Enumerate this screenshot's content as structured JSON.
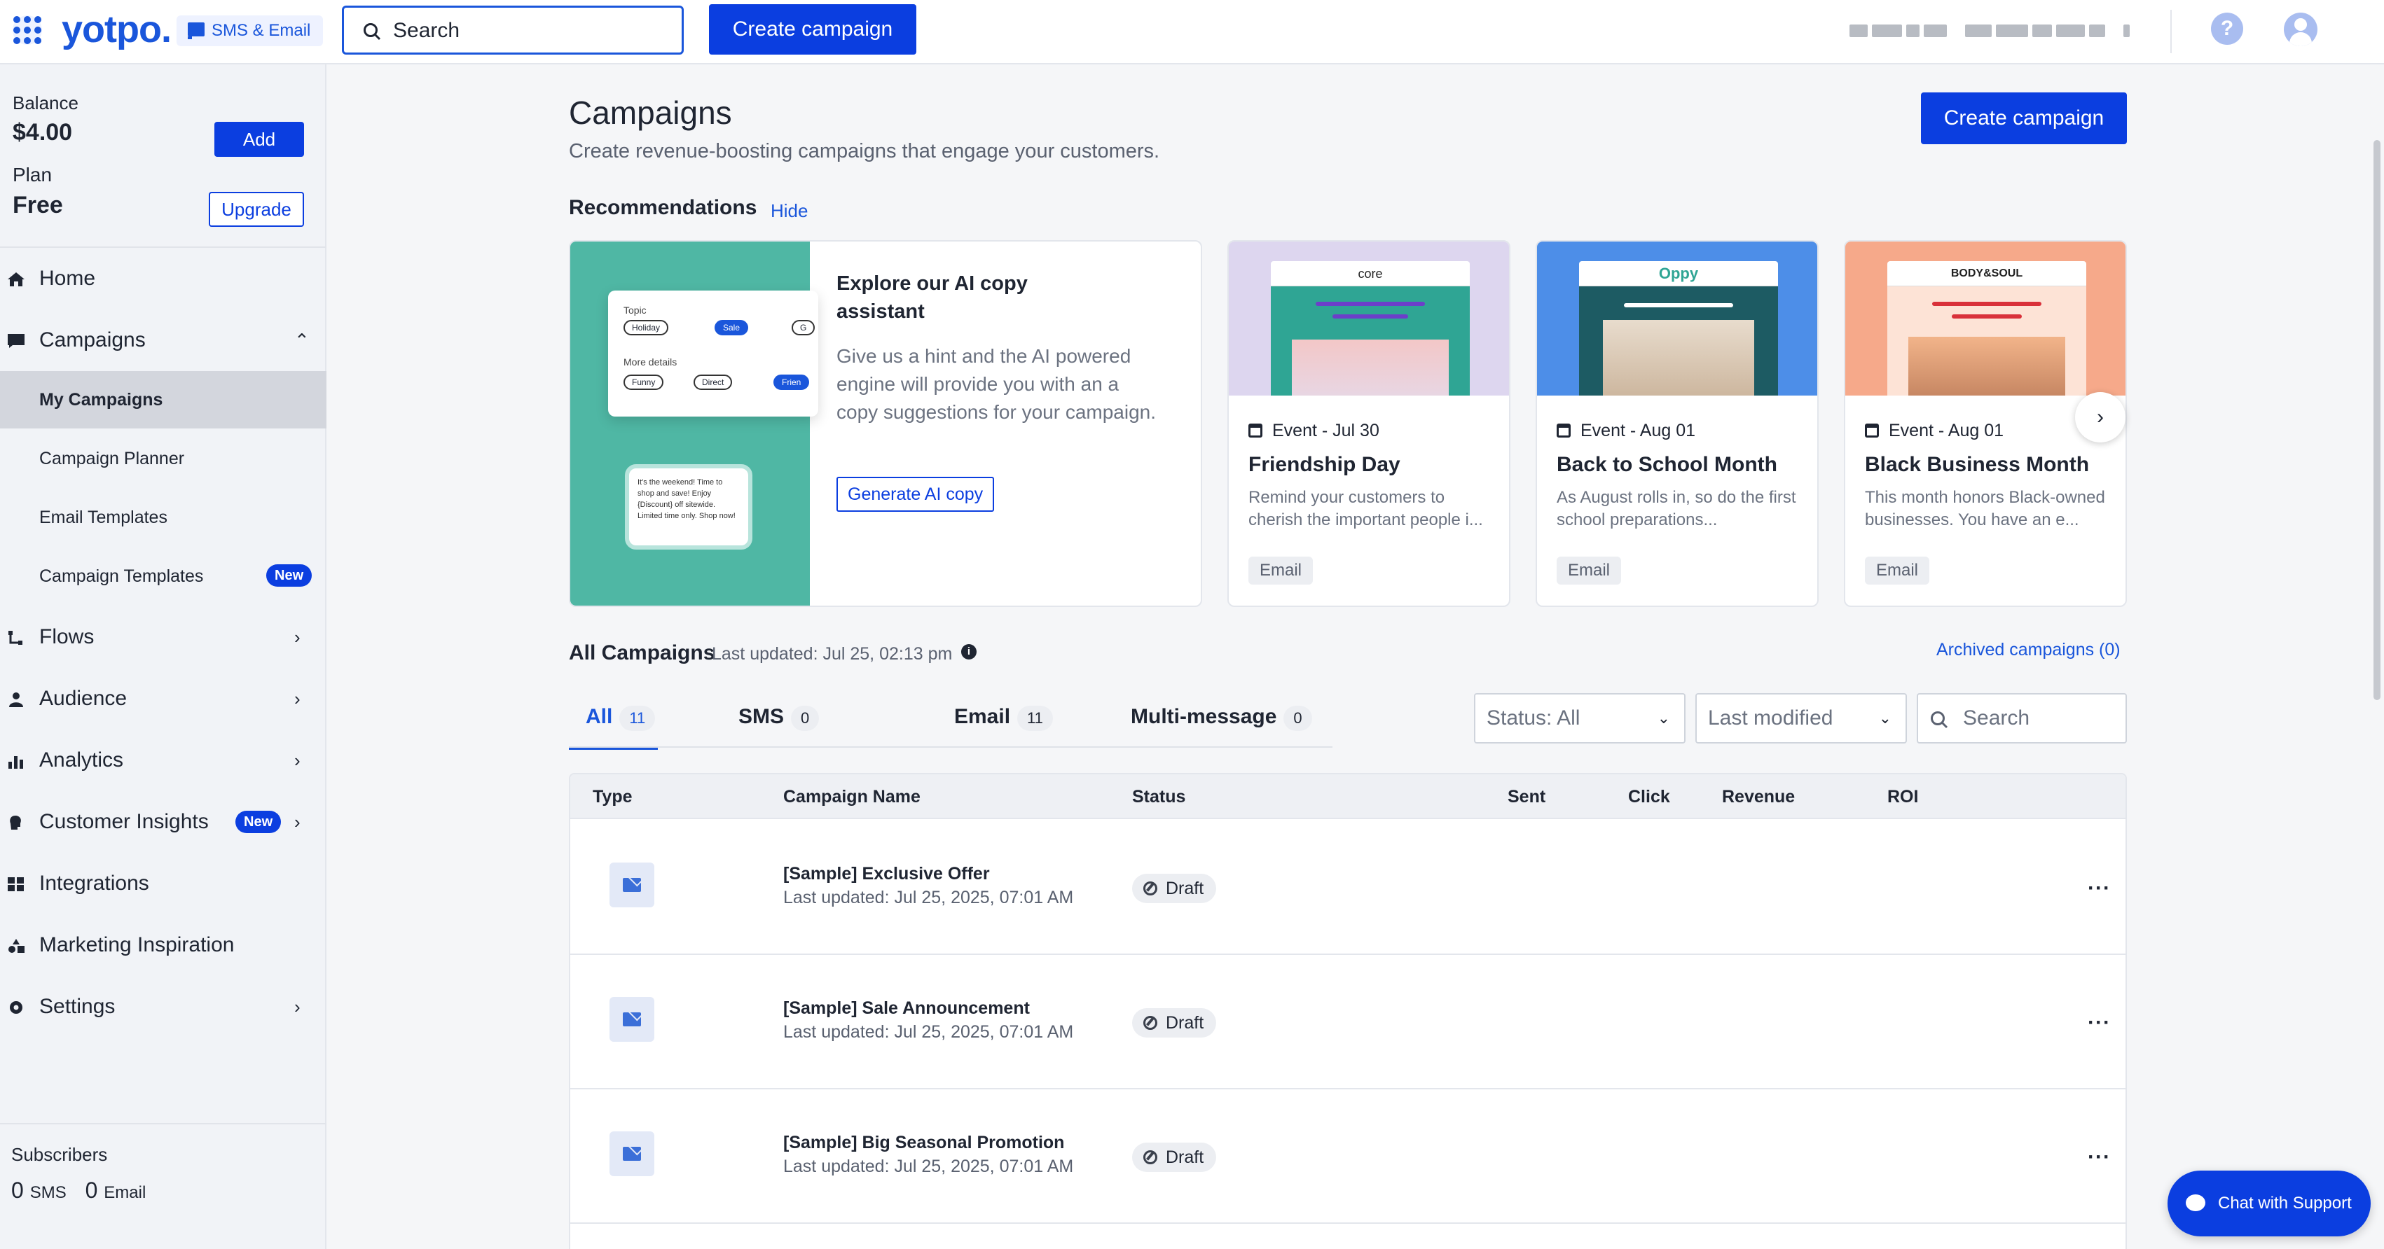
{
  "brand": {
    "logo": "yotpo.",
    "product": "SMS & Email"
  },
  "topbar": {
    "search_placeholder": "Search",
    "create_label": "Create campaign",
    "help_glyph": "?"
  },
  "sidebar": {
    "balance_label": "Balance",
    "balance_value": "$4.00",
    "add_label": "Add",
    "plan_label": "Plan",
    "plan_value": "Free",
    "upgrade_label": "Upgrade",
    "items": [
      {
        "label": "Home",
        "icon": "home-icon"
      },
      {
        "label": "Campaigns",
        "icon": "campaigns-icon",
        "expanded": true
      },
      {
        "label": "Flows",
        "icon": "flows-icon"
      },
      {
        "label": "Audience",
        "icon": "audience-icon"
      },
      {
        "label": "Analytics",
        "icon": "analytics-icon"
      },
      {
        "label": "Customer Insights",
        "icon": "insights-icon",
        "badge": "New"
      },
      {
        "label": "Integrations",
        "icon": "integrations-icon"
      },
      {
        "label": "Marketing Inspiration",
        "icon": "inspiration-icon"
      },
      {
        "label": "Settings",
        "icon": "settings-icon"
      }
    ],
    "subitems": [
      {
        "label": "My Campaigns",
        "active": true
      },
      {
        "label": "Campaign Planner"
      },
      {
        "label": "Email Templates"
      },
      {
        "label": "Campaign Templates",
        "badge": "New"
      }
    ],
    "subscribers_label": "Subscribers",
    "sms_count": "0",
    "sms_label": "SMS",
    "email_count": "0",
    "email_label": "Email"
  },
  "main": {
    "title": "Campaigns",
    "subtitle": "Create revenue-boosting campaigns that engage your customers.",
    "create_label": "Create campaign",
    "recommendations_label": "Recommendations",
    "hide_label": "Hide",
    "ai_card": {
      "title": "Explore our AI copy assistant",
      "description": "Give us a hint and the AI powered engine will provide you with an a copy suggestions for your campaign.",
      "button": "Generate AI copy",
      "art": {
        "topic_label": "Topic",
        "pills1": [
          "Holiday",
          "Sale",
          "G"
        ],
        "details_label": "More details",
        "pills2": [
          "Funny",
          "Direct",
          "Frien"
        ],
        "bubble": "It's the weekend! Time to shop and save! Enjoy {Discount} off sitewide. Limited time only. Shop now!"
      }
    },
    "events": [
      {
        "meta": "Event - Jul 30",
        "name": "Friendship Day",
        "desc": "Remind your customers to cherish the important people i...",
        "tag": "Email",
        "brand": "core",
        "hero": "#ddd6ef",
        "band": "#2fa594",
        "line": "#6c3fc9"
      },
      {
        "meta": "Event - Aug 01",
        "name": "Back to School Month",
        "desc": "As August rolls in, so do the first school preparations...",
        "tag": "Email",
        "brand": "Oppy",
        "hero": "#4d8ee8",
        "band": "#1d5b63",
        "line": "#ffffff"
      },
      {
        "meta": "Event - Aug 01",
        "name": "Black Business Month",
        "desc": "This month honors Black-owned businesses. You have an e...",
        "tag": "Email",
        "brand": "BODY&SOUL",
        "hero": "#f6a98a",
        "band": "#fde3d6",
        "line": "#d9313a"
      }
    ],
    "next_glyph": "›",
    "all_title": "All Campaigns",
    "all_updated": "Last updated: Jul 25, 02:13 pm",
    "info_glyph": "i",
    "archived": "Archived campaigns (0)",
    "tabs": [
      {
        "label": "All",
        "count": "11",
        "active": true
      },
      {
        "label": "SMS",
        "count": "0"
      },
      {
        "label": "Email",
        "count": "11"
      },
      {
        "label": "Multi-message",
        "count": "0"
      }
    ],
    "status_filter": "Status: All",
    "sort_filter": "Last modified",
    "search_placeholder": "Search",
    "columns": [
      "Type",
      "Campaign Name",
      "Status",
      "Sent",
      "Click",
      "Revenue",
      "ROI"
    ],
    "rows": [
      {
        "name": "[Sample] Exclusive Offer",
        "updated": "Last updated: Jul 25, 2025, 07:01 AM",
        "status": "Draft"
      },
      {
        "name": "[Sample] Sale Announcement",
        "updated": "Last updated: Jul 25, 2025, 07:01 AM",
        "status": "Draft"
      },
      {
        "name": "[Sample] Big Seasonal Promotion",
        "updated": "Last updated: Jul 25, 2025, 07:01 AM",
        "status": "Draft"
      }
    ],
    "menu_glyph": "···"
  },
  "chat": {
    "label": "Chat with Support"
  }
}
